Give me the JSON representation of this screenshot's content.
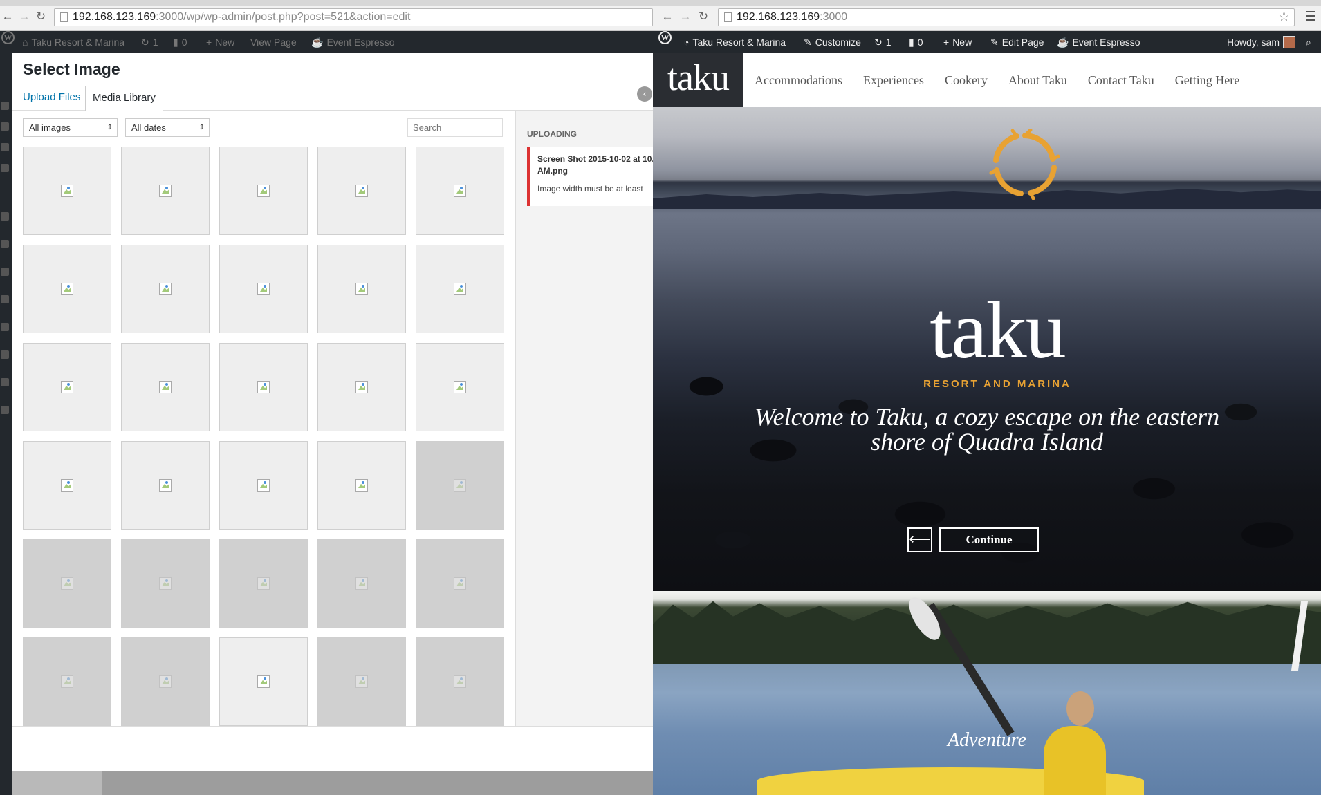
{
  "left_browser": {
    "url_host": "192.168.123.169",
    "url_rest": ":3000/wp/wp-admin/post.php?post=521&action=edit",
    "admin_bar": {
      "site_name": "Taku Resort & Marina",
      "updates_count": "1",
      "comments_count": "0",
      "new_label": "New",
      "view_page_label": "View Page",
      "event_espresso_label": "Event Espresso"
    },
    "modal": {
      "title": "Select Image",
      "tabs": [
        "Upload Files",
        "Media Library"
      ],
      "filter_type": "All images",
      "filter_date": "All dates",
      "search_placeholder": "Search",
      "thumbnail_count": 30,
      "uploading": {
        "heading": "UPLOADING",
        "filename_line1": "Screen Shot 2015-10-02 at 10.",
        "filename_line2": "AM.png",
        "message": "Image width must be at least"
      }
    }
  },
  "right_browser": {
    "url_host": "192.168.123.169",
    "url_rest": ":3000",
    "admin_bar": {
      "site_name": "Taku Resort & Marina",
      "customize_label": "Customize",
      "updates_count": "1",
      "comments_count": "0",
      "new_label": "New",
      "edit_page_label": "Edit Page",
      "event_espresso_label": "Event Espresso",
      "howdy_label": "Howdy, sam"
    },
    "site": {
      "logo_text": "taku",
      "nav": [
        "Accommodations",
        "Experiences",
        "Cookery",
        "About Taku",
        "Contact Taku",
        "Getting Here"
      ],
      "hero_logo": "taku",
      "hero_logo_sub": "RESORT AND MARINA",
      "hero_tagline": "Welcome to Taku, a cozy escape on the eastern shore of Quadra Island",
      "continue_label": "Continue",
      "prev_arrow": "⟵",
      "adventure_label": "Adventure"
    }
  },
  "colors": {
    "wp_admin_bar": "#23282d",
    "wp_link": "#0073aa",
    "error_border": "#dc3232",
    "taku_orange": "#e8a233"
  }
}
